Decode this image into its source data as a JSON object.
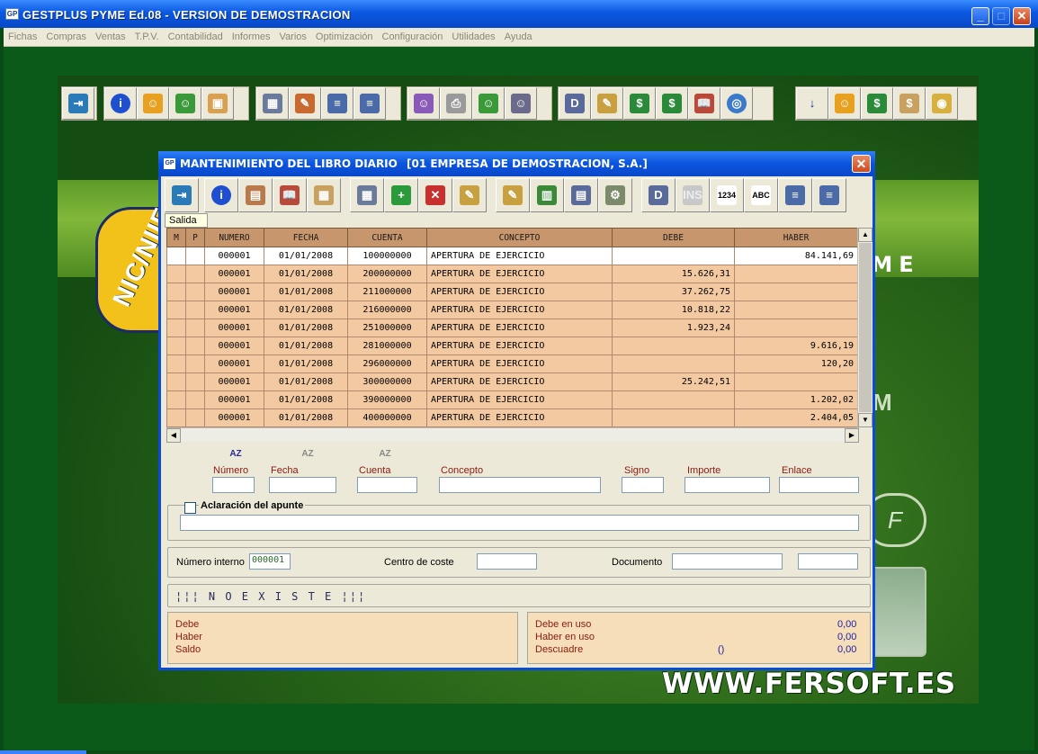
{
  "window": {
    "title": "GESTPLUS  PYME  Ed.08  -  VERSION DE DEMOSTRACION",
    "app_icon": "GP"
  },
  "menu": [
    "Fichas",
    "Compras",
    "Ventas",
    "T.P.V.",
    "Contabilidad",
    "Informes",
    "Varios",
    "Optimización",
    "Configuración",
    "Utilidades",
    "Ayuda"
  ],
  "background": {
    "brand_suffix": "YME",
    "site": "WWW.FERSOFT.ES",
    "badge": "NIC/NIIF",
    "m_letter": "M",
    "fersoft_mark": "F"
  },
  "dialog": {
    "title": "MANTENIMIENTO DEL LIBRO DIARIO",
    "company": "[01  EMPRESA DE DEMOSTRACION, S.A.]",
    "tooltip": "Salida",
    "columns": [
      "M",
      "P",
      "NUMERO",
      "FECHA",
      "CUENTA",
      "CONCEPTO",
      "DEBE",
      "HABER"
    ],
    "rows": [
      {
        "numero": "000001",
        "fecha": "01/01/2008",
        "cuenta": "100000000",
        "concepto": "APERTURA DE EJERCICIO",
        "debe": "",
        "haber": "84.141,69"
      },
      {
        "numero": "000001",
        "fecha": "01/01/2008",
        "cuenta": "200000000",
        "concepto": "APERTURA DE EJERCICIO",
        "debe": "15.626,31",
        "haber": ""
      },
      {
        "numero": "000001",
        "fecha": "01/01/2008",
        "cuenta": "211000000",
        "concepto": "APERTURA DE EJERCICIO",
        "debe": "37.262,75",
        "haber": ""
      },
      {
        "numero": "000001",
        "fecha": "01/01/2008",
        "cuenta": "216000000",
        "concepto": "APERTURA DE EJERCICIO",
        "debe": "10.818,22",
        "haber": ""
      },
      {
        "numero": "000001",
        "fecha": "01/01/2008",
        "cuenta": "251000000",
        "concepto": "APERTURA DE EJERCICIO",
        "debe": "1.923,24",
        "haber": ""
      },
      {
        "numero": "000001",
        "fecha": "01/01/2008",
        "cuenta": "281000000",
        "concepto": "APERTURA DE EJERCICIO",
        "debe": "",
        "haber": "9.616,19"
      },
      {
        "numero": "000001",
        "fecha": "01/01/2008",
        "cuenta": "296000000",
        "concepto": "APERTURA DE EJERCICIO",
        "debe": "",
        "haber": "120,20"
      },
      {
        "numero": "000001",
        "fecha": "01/01/2008",
        "cuenta": "300000000",
        "concepto": "APERTURA DE EJERCICIO",
        "debe": "25.242,51",
        "haber": ""
      },
      {
        "numero": "000001",
        "fecha": "01/01/2008",
        "cuenta": "390000000",
        "concepto": "APERTURA DE EJERCICIO",
        "debe": "",
        "haber": "1.202,02"
      },
      {
        "numero": "000001",
        "fecha": "01/01/2008",
        "cuenta": "400000000",
        "concepto": "APERTURA DE EJERCICIO",
        "debe": "",
        "haber": "2.404,05"
      }
    ],
    "filters": {
      "numero": "Número",
      "fecha": "Fecha",
      "cuenta": "Cuenta",
      "concepto": "Concepto",
      "signo": "Signo",
      "importe": "Importe",
      "enlace": "Enlace"
    },
    "sort_glyph": "AZ",
    "aclaracion_label": "Aclaración del apunte",
    "numero_interno_label": "Número interno",
    "numero_interno_value": "000001",
    "centro_coste_label": "Centro de coste",
    "documento_label": "Documento",
    "status": "¦¦¦ N O  E X I S T E  ¦¦¦",
    "totals_left": {
      "debe": "Debe",
      "haber": "Haber",
      "saldo": "Saldo"
    },
    "totals_right": {
      "debe_uso_label": "Debe en uso",
      "haber_uso_label": "Haber en uso",
      "descuadre_label": "Descuadre",
      "debe_uso": "0,00",
      "haber_uso": "0,00",
      "descuadre": "0,00",
      "descuadre_mid": "()"
    }
  },
  "colors": {
    "row_bg": "#f3c9a1",
    "header_bg": "#c8966c",
    "titlebar": "#0a54de"
  }
}
